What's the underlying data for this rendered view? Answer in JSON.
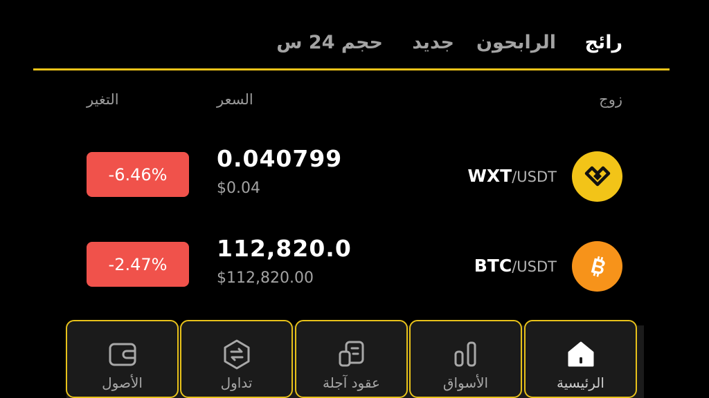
{
  "tabs": [
    {
      "label": "رائج",
      "active": true
    },
    {
      "label": "الرابحون",
      "active": false
    },
    {
      "label": "جديد",
      "active": false
    },
    {
      "label": "حجم 24 س",
      "active": false
    }
  ],
  "columns": {
    "pair": "زوج",
    "price": "السعر",
    "change": "التغير"
  },
  "rows": [
    {
      "base": "WXT",
      "quote": "/USDT",
      "price": "0.040799",
      "price_usd": "$0.04",
      "change": "-6.46%",
      "icon": "wxt-coin-icon"
    },
    {
      "base": "BTC",
      "quote": "/USDT",
      "price": "112,820.0",
      "price_usd": "$112,820.00",
      "change": "-2.47%",
      "icon": "bitcoin-icon"
    }
  ],
  "nav": [
    {
      "label": "الرئيسية",
      "icon": "home-icon",
      "active": true
    },
    {
      "label": "الأسواق",
      "icon": "markets-icon",
      "active": false
    },
    {
      "label": "عقود آجلة",
      "icon": "futures-icon",
      "active": false
    },
    {
      "label": "تداول",
      "icon": "trade-icon",
      "active": false
    },
    {
      "label": "الأصول",
      "icon": "wallet-icon",
      "active": false
    }
  ],
  "colors": {
    "accent": "#f0c419",
    "negative": "#f0524b",
    "background": "#000000",
    "nav_background": "#1b1b1b"
  }
}
